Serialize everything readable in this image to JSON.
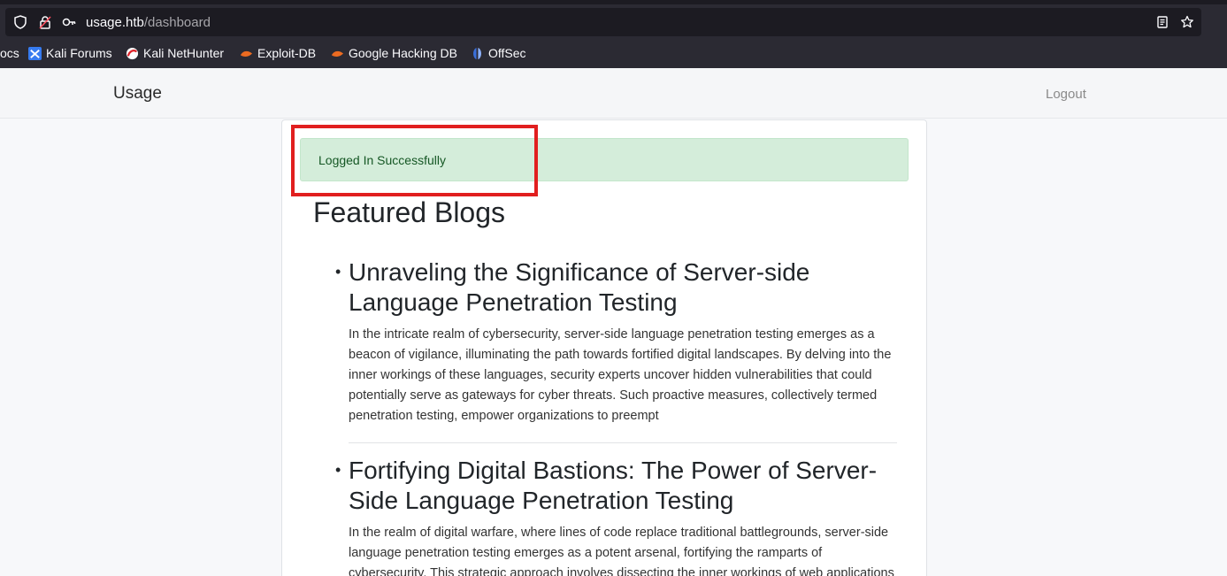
{
  "browser": {
    "url_host": "usage.htb",
    "url_path": "/dashboard",
    "bookmarks": [
      {
        "label": "ocs",
        "icon": "kali-docs-icon"
      },
      {
        "label": "Kali Forums",
        "icon": "kali-forums-icon"
      },
      {
        "label": "Kali NetHunter",
        "icon": "kali-nethunter-icon"
      },
      {
        "label": "Exploit-DB",
        "icon": "exploit-db-icon"
      },
      {
        "label": "Google Hacking DB",
        "icon": "ghdb-icon"
      },
      {
        "label": "OffSec",
        "icon": "offsec-icon"
      }
    ]
  },
  "navbar": {
    "brand": "Usage",
    "logout": "Logout"
  },
  "alert": {
    "message": "Logged In Successfully",
    "color": "#d4edda"
  },
  "main": {
    "section_title": "Featured Blogs",
    "posts": [
      {
        "title": "Unraveling the Significance of Server-side Language Penetration Testing",
        "body": "In the intricate realm of cybersecurity, server-side language penetration testing emerges as a beacon of vigilance, illuminating the path towards fortified digital landscapes. By delving into the inner workings of these languages, security experts uncover hidden vulnerabilities that could potentially serve as gateways for cyber threats. Such proactive measures, collectively termed penetration testing, empower organizations to preempt"
      },
      {
        "title": "Fortifying Digital Bastions: The Power of Server-Side Language Penetration Testing",
        "body": "In the realm of digital warfare, where lines of code replace traditional battlegrounds, server-side language penetration testing emerges as a potent arsenal, fortifying the ramparts of cybersecurity. This strategic approach involves dissecting the inner workings of web applications"
      }
    ]
  },
  "colors": {
    "highlight_box": "#e11f1f",
    "alert_text": "#155724"
  }
}
